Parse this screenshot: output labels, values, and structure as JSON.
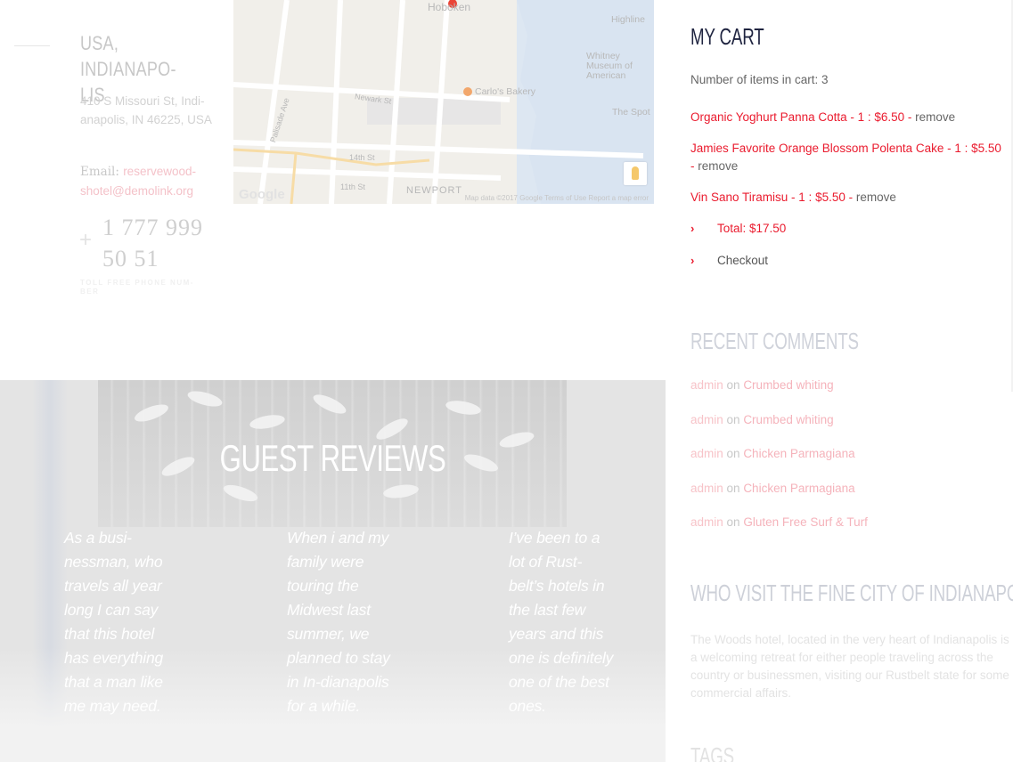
{
  "contact": {
    "location": "USA, INDIANAPO-LIS",
    "address": "410 S Missouri St, Indi-anapolis, IN 46225, USA",
    "email_label": "Email:",
    "email": "reservewood-shotel@demolink.org",
    "plus": "+",
    "phone": "1 777 999 50 51",
    "phone_caption": "TOLL FREE PHONE NUM-BER"
  },
  "map": {
    "labels": [
      "Hoboken",
      "Highline",
      "Whitney Museum of American",
      "Carlo's Bakery",
      "Newark St",
      "14th St",
      "11th St",
      "NEWPORT",
      "The Spot",
      "Palisade Ave"
    ],
    "footer": "Map data ©2017 Google   Terms of Use   Report a map error",
    "brand": "Google"
  },
  "reviews": {
    "title": "GUEST REVIEWS",
    "quotes": [
      "As a busi-nessman, who travels all year long I can say that this hotel has everything that a man like me may need.",
      "When i and my family were touring the Midwest last summer, we planned to stay in In-dianapolis for a while.",
      "I’ve been to a lot of Rust-belt’s hotels in the last few years and this one is definitely one of the best ones."
    ]
  },
  "cart": {
    "title": "MY CART",
    "count_text": "Number of items in cart: 3",
    "items": [
      {
        "text": "Organic Yoghurt Panna Cotta - 1 :  $6.50 - ",
        "remove": "remove"
      },
      {
        "text": "Jamies Favorite Orange Blossom Polenta Cake - 1 :  $5.50 - ",
        "remove": "remove"
      },
      {
        "text": "Vin Sano Tiramisu - 1 :  $5.50 - ",
        "remove": "remove"
      }
    ],
    "chevron": "›",
    "total": "Total: $17.50",
    "checkout": "Checkout"
  },
  "recent_comments": {
    "title": "RECENT COMMENTS",
    "items": [
      {
        "author": "admin",
        "on": " on ",
        "post": "Crumbed whiting"
      },
      {
        "author": "admin",
        "on": " on ",
        "post": "Crumbed whiting"
      },
      {
        "author": "admin",
        "on": " on ",
        "post": "Chicken Parmagiana"
      },
      {
        "author": "admin",
        "on": " on ",
        "post": "Chicken Parmagiana"
      },
      {
        "author": "admin",
        "on": " on ",
        "post": "Gluten Free Surf & Turf"
      }
    ]
  },
  "who_visit": {
    "title": "WHO VISIT THE FINE CITY OF INDIANAPOLIS",
    "text": "The Woods hotel, located in the very heart of Indianapolis is a welcoming retreat for either people traveling across the country or businessmen, visiting our Rustbelt state for some commercial affairs."
  },
  "tags": {
    "title": "TAGS"
  },
  "colors": {
    "accent": "#ea1b2e",
    "heading_dark": "#1f2440"
  }
}
